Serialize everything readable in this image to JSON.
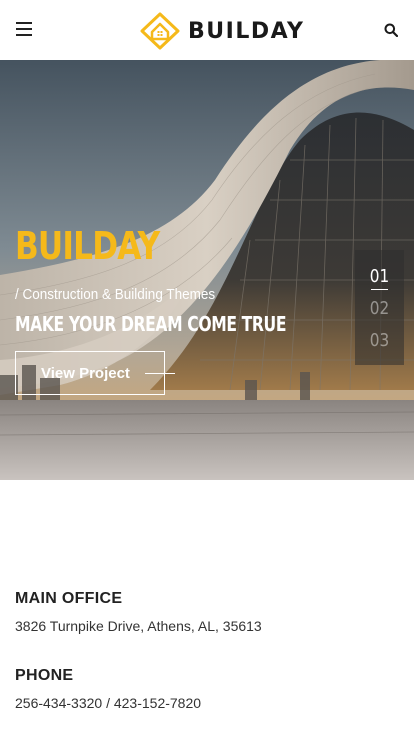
{
  "header": {
    "brand": "BUILDAY",
    "accent_color": "#f5b91a",
    "menu_icon": "hamburger-menu-icon",
    "search_icon": "search-icon"
  },
  "hero": {
    "title": "BUILDAY",
    "subtitle": "/ Construction & Building Themes",
    "tagline": "MAKE YOUR DREAM COME TRUE",
    "button_label": "View Project",
    "slides": [
      "01",
      "02",
      "03"
    ],
    "active_slide": "01"
  },
  "contact": {
    "office_label": "MAIN OFFICE",
    "office_address": "3826 Turnpike Drive, Athens, AL, 35613",
    "phone_label": "PHONE",
    "phone_numbers": "256-434-3320 / 423-152-7820"
  }
}
